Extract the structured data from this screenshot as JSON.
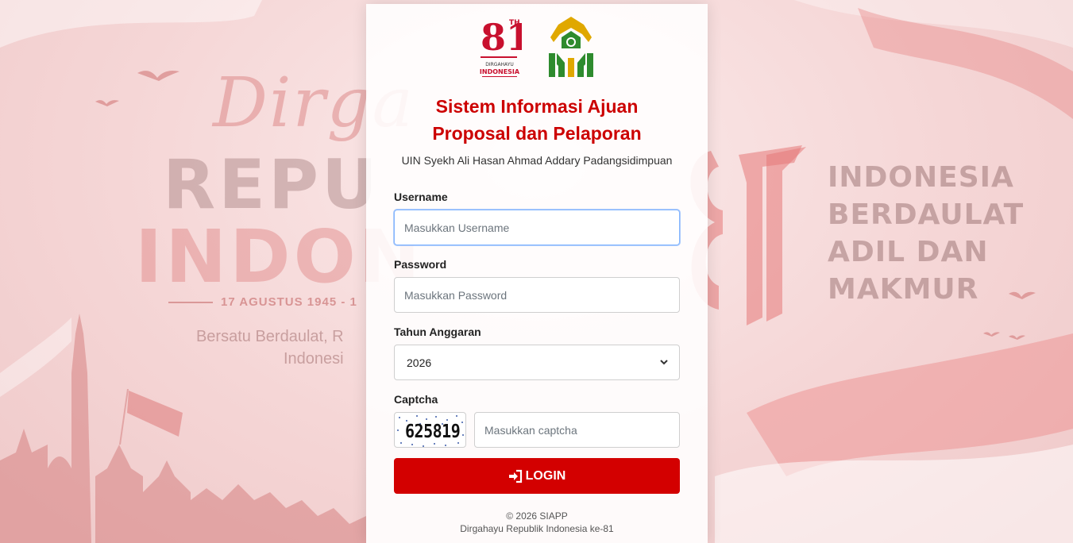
{
  "background": {
    "left_script": "Dirga",
    "left_big_1": "REPU",
    "left_big_2": "INDON",
    "left_date": "17 AGUSTUS 1945 - 1",
    "left_tagline_1": "Bersatu Berdaulat, R",
    "left_tagline_2": "Indonesi",
    "right_lines": [
      "INDONESIA",
      "BERDAULAT",
      "ADIL DAN",
      "MAKMUR"
    ]
  },
  "logos": {
    "left_text_1": "DIRGAHAYU",
    "left_text_2": "INDONESIA",
    "left_number": "81",
    "left_sup": "TH"
  },
  "header": {
    "title_line1": "Sistem Informasi Ajuan",
    "title_line2": "Proposal dan Pelaporan",
    "subtitle": "UIN Syekh Ali Hasan Ahmad Addary Padangsidimpuan"
  },
  "form": {
    "username_label": "Username",
    "username_placeholder": "Masukkan Username",
    "password_label": "Password",
    "password_placeholder": "Masukkan Password",
    "tahun_label": "Tahun Anggaran",
    "tahun_value": "2026",
    "captcha_label": "Captcha",
    "captcha_code": "625819",
    "captcha_placeholder": "Masukkan captcha",
    "login_label": "LOGIN"
  },
  "footer": {
    "line1": "© 2026 SIAPP",
    "line2": "Dirgahayu Republik Indonesia ke-81"
  },
  "colors": {
    "accent": "#cc0000",
    "button": "#d30000",
    "background": "#f6dada"
  }
}
